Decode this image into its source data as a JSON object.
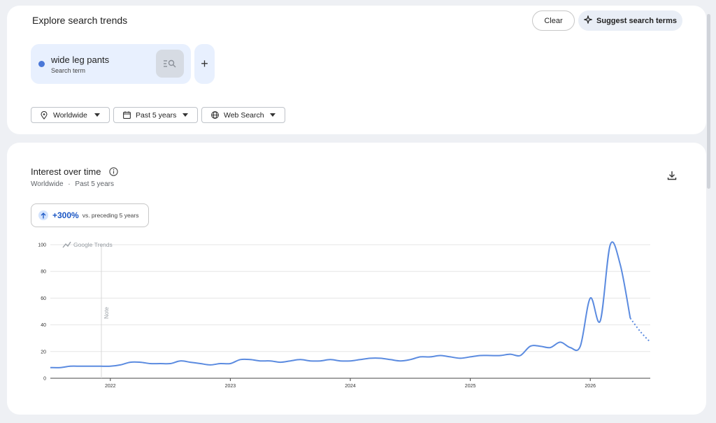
{
  "header": {
    "title": "Explore search trends",
    "clear_label": "Clear",
    "suggest_label": "Suggest search terms"
  },
  "search_term": {
    "name": "wide leg pants",
    "type": "Search term",
    "color": "#4a78d8"
  },
  "add_label": "+",
  "filters": {
    "location": "Worldwide",
    "time_range": "Past 5 years",
    "property": "Web Search"
  },
  "chart_section": {
    "title": "Interest over time",
    "subtitle_location": "Worldwide",
    "subtitle_separator": "·",
    "subtitle_range": "Past 5 years",
    "delta_value": "+300%",
    "delta_label": "vs. preceding 5 years",
    "watermark": "Google Trends",
    "note_label": "Note"
  },
  "icons": {
    "location": "location-pin-icon",
    "calendar": "calendar-icon",
    "globe": "globe-icon",
    "suggest": "sparkle-icon",
    "search_list": "search-list-icon",
    "info": "info-icon",
    "download": "download-icon"
  },
  "chart_data": {
    "type": "line",
    "title": "",
    "ylim": [
      0,
      100
    ],
    "y_ticks": [
      0,
      20,
      40,
      60,
      80,
      100
    ],
    "x_ticks": [
      "2022",
      "2023",
      "2024",
      "2025",
      "2026"
    ],
    "grid": true,
    "series": [
      {
        "name": "wide leg pants",
        "color": "#5b8be0",
        "x": [
          "2021-07",
          "2021-08",
          "2021-09",
          "2021-10",
          "2021-11",
          "2021-12",
          "2022-01",
          "2022-02",
          "2022-03",
          "2022-04",
          "2022-05",
          "2022-06",
          "2022-07",
          "2022-08",
          "2022-09",
          "2022-10",
          "2022-11",
          "2022-12",
          "2023-01",
          "2023-02",
          "2023-03",
          "2023-04",
          "2023-05",
          "2023-06",
          "2023-07",
          "2023-08",
          "2023-09",
          "2023-10",
          "2023-11",
          "2023-12",
          "2024-01",
          "2024-02",
          "2024-03",
          "2024-04",
          "2024-05",
          "2024-06",
          "2024-07",
          "2024-08",
          "2024-09",
          "2024-10",
          "2024-11",
          "2024-12",
          "2025-01",
          "2025-02",
          "2025-03",
          "2025-04",
          "2025-05",
          "2025-06",
          "2025-07",
          "2025-08",
          "2025-09",
          "2025-10",
          "2025-11",
          "2025-12",
          "2026-01",
          "2026-02",
          "2026-03",
          "2026-04",
          "2026-05",
          "2026-06",
          "2026-07"
        ],
        "values": [
          8,
          8,
          9,
          9,
          9,
          9,
          9,
          10,
          12,
          12,
          11,
          11,
          11,
          13,
          12,
          11,
          10,
          11,
          11,
          14,
          14,
          13,
          13,
          12,
          13,
          14,
          13,
          13,
          14,
          13,
          13,
          14,
          15,
          15,
          14,
          13,
          14,
          16,
          16,
          17,
          16,
          15,
          16,
          17,
          17,
          17,
          18,
          17,
          24,
          24,
          23,
          27,
          23,
          24,
          60,
          43,
          100,
          85,
          45,
          35,
          27
        ],
        "partial_from_index": 58
      }
    ]
  }
}
